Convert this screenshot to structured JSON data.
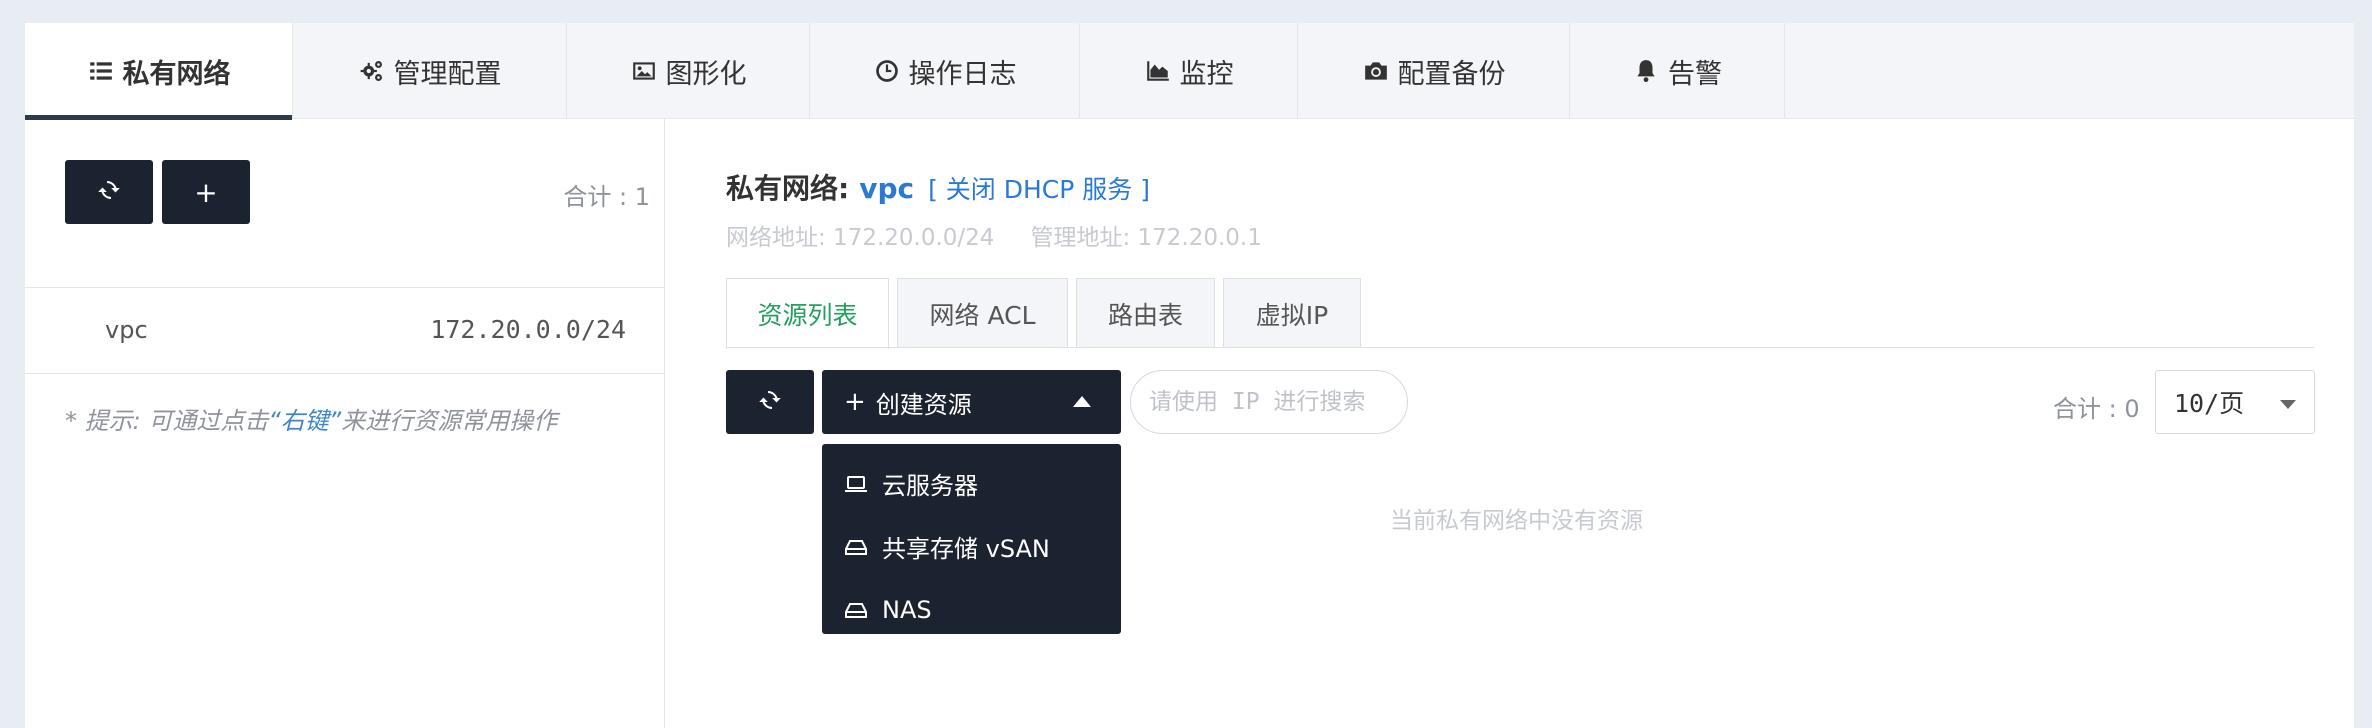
{
  "nav": {
    "tabs": [
      {
        "label": "私有网络",
        "icon": "list-icon",
        "active": true
      },
      {
        "label": "管理配置",
        "icon": "gears-icon",
        "active": false
      },
      {
        "label": "图形化",
        "icon": "image-icon",
        "active": false
      },
      {
        "label": "操作日志",
        "icon": "clock-icon",
        "active": false
      },
      {
        "label": "监控",
        "icon": "area-chart-icon",
        "active": false
      },
      {
        "label": "配置备份",
        "icon": "camera-icon",
        "active": false
      },
      {
        "label": "告警",
        "icon": "bell-icon",
        "active": false
      }
    ]
  },
  "left": {
    "add_label": "+",
    "total": "合计 : 1",
    "vpc_list": [
      {
        "name": "vpc",
        "cidr": "172.20.0.0/24"
      }
    ],
    "hint_prefix": "* 提示: 可通过点击",
    "hint_key": "“右键”",
    "hint_suffix": "来进行资源常用操作"
  },
  "main": {
    "title_label": "私有网络:",
    "vpc_name": "vpc",
    "dhcp_link": "[ 关闭 DHCP 服务 ]",
    "network_addr": "网络地址: 172.20.0.0/24",
    "mgmt_addr": "管理地址: 172.20.0.1",
    "subtabs": [
      {
        "label": "资源列表",
        "active": true
      },
      {
        "label": "网络 ACL",
        "active": false
      },
      {
        "label": "路由表",
        "active": false
      },
      {
        "label": "虚拟IP",
        "active": false
      }
    ],
    "create_label": "创建资源",
    "create_plus": "+",
    "search_placeholder": "请使用 IP 进行搜索",
    "total": "合计 : 0",
    "page_size": "10/页",
    "empty_text": "当前私有网络中没有资源",
    "dropdown": [
      {
        "label": "云服务器",
        "icon": "laptop-icon"
      },
      {
        "label": "共享存储 vSAN",
        "icon": "hdd-icon"
      },
      {
        "label": "NAS",
        "icon": "hdd-icon"
      }
    ]
  },
  "colors": {
    "accent": "#2a7ad4",
    "active_tab_text": "#23a05f",
    "dark_button": "#1c2330"
  }
}
